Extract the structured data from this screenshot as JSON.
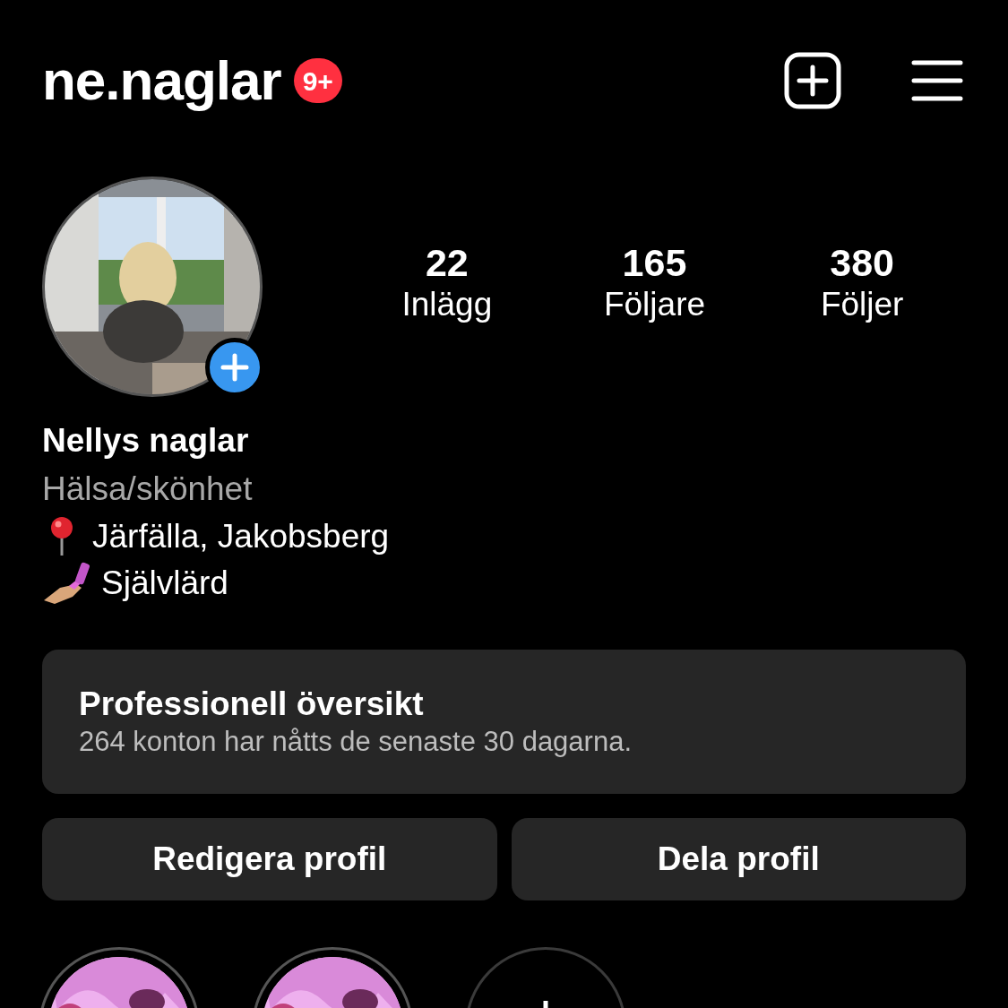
{
  "header": {
    "username": "ne.naglar",
    "badge": "9+"
  },
  "profile": {
    "stats": [
      {
        "value": "22",
        "label": "Inlägg"
      },
      {
        "value": "165",
        "label": "Följare"
      },
      {
        "value": "380",
        "label": "Följer"
      }
    ],
    "name": "Nellys naglar",
    "category": "Hälsa/skönhet",
    "bio": [
      {
        "kind": "pin",
        "text": "Järfälla, Jakobsberg"
      },
      {
        "kind": "nail",
        "text": "Självlärd"
      }
    ]
  },
  "dashboard": {
    "title": "Professionell översikt",
    "subtitle": "264 konton har nåtts de senaste 30 dagarna."
  },
  "buttons": [
    "Redigera profil",
    "Dela profil"
  ],
  "highlights": [
    {
      "kind": "picture"
    },
    {
      "kind": "picture"
    },
    {
      "kind": "new"
    }
  ]
}
